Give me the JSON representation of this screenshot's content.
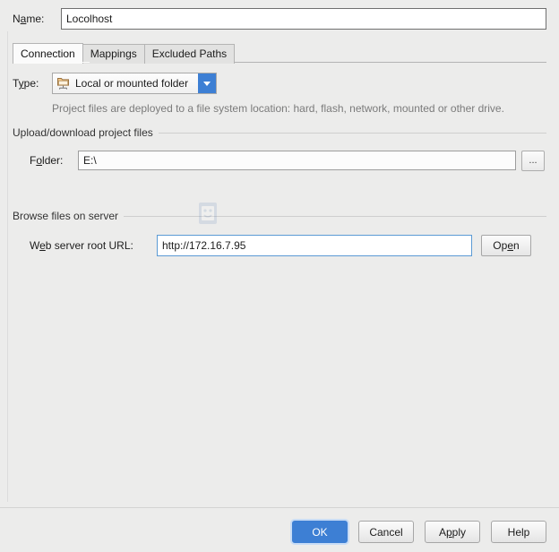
{
  "dialog": {
    "name_field": {
      "label_pre": "N",
      "label_mn": "a",
      "label_post": "me:",
      "value": "Locolhost"
    },
    "tabs": [
      {
        "label": "Connection",
        "active": true
      },
      {
        "label": "Mappings",
        "active": false
      },
      {
        "label": "Excluded Paths",
        "active": false
      }
    ],
    "type_row": {
      "label_pre": "T",
      "label_mn": "y",
      "label_post": "pe:",
      "selected": "Local or mounted folder",
      "icon": "local-folder-icon",
      "arrow_icon": "chevron-down-icon",
      "arrow_color": "#3d7fd4"
    },
    "description": "Project files are deployed to a file system location: hard, flash, network, mounted or other drive.",
    "group_upload": {
      "title": "Upload/download project files",
      "folder": {
        "label_pre": "F",
        "label_mn": "o",
        "label_post": "lder:",
        "value": "E:\\",
        "browse_label": "..."
      }
    },
    "group_browse": {
      "title": "Browse files on server",
      "web": {
        "label_pre": "W",
        "label_mn": "e",
        "label_post": "b server root URL:",
        "value": "http://172.16.7.95",
        "focus_color": "#5b9ad4",
        "open_pre": "Op",
        "open_mn": "e",
        "open_post": "n"
      }
    },
    "footer": {
      "ok": "OK",
      "cancel": "Cancel",
      "apply_pre": "A",
      "apply_mn": "p",
      "apply_post": "ply",
      "help": "Help",
      "ok_color": "#3d7fd4"
    }
  }
}
